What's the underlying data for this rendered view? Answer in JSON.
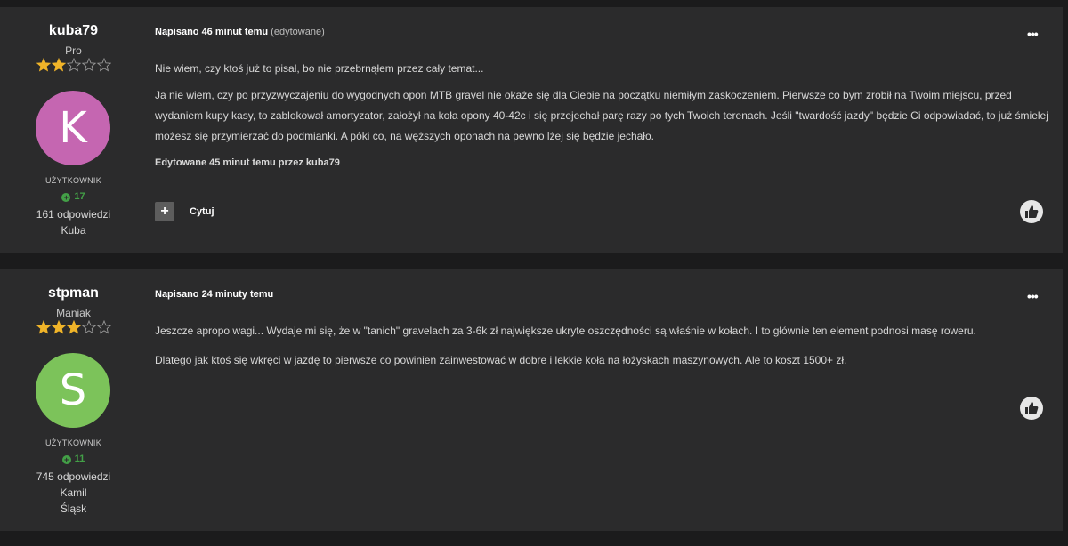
{
  "posts": [
    {
      "username": "kuba79",
      "rank": "Pro",
      "stars_filled": 2,
      "stars_total": 5,
      "avatar_letter": "K",
      "avatar_color": "#c566b1",
      "role": "UŻYTKOWNIK",
      "reputation": "17",
      "replies": "161 odpowiedzi",
      "name": "Kuba",
      "location": "",
      "posted": "Napisano 46 minut temu",
      "edited_flag": "(edytowane)",
      "paragraphs": [
        "Nie wiem, czy ktoś już to pisał, bo nie przebrnąłem przez cały temat...",
        "Ja nie wiem, czy po przyzwyczajeniu do wygodnych opon MTB gravel nie okaże się dla Ciebie na początku niemiłym zaskoczeniem. Pierwsze co bym zrobił na Twoim miejscu, przed wydaniem kupy kasy, to zablokował amortyzator, założył na koła opony 40-42c i się przejechał parę razy po tych Twoich terenach. Jeśli \"twardość jazdy\" będzie Ci odpowiadać, to już śmielej możesz się przymierzać do podmianki. A póki co, na węższych oponach na pewno lżej się będzie jechało."
      ],
      "edit_note": "Edytowane 45 minut temu przez kuba79",
      "quote_label": "Cytuj",
      "plus_label": "+",
      "more_label": "•••"
    },
    {
      "username": "stpman",
      "rank": "Maniak",
      "stars_filled": 3,
      "stars_total": 5,
      "avatar_letter": "S",
      "avatar_color": "#7cc35a",
      "role": "UŻYTKOWNIK",
      "reputation": "11",
      "replies": "745 odpowiedzi",
      "name": "Kamil",
      "location": "Śląsk",
      "posted": "Napisano 24 minuty temu",
      "edited_flag": "",
      "paragraphs": [
        "Jeszcze apropo wagi... Wydaje mi się, że w \"tanich\" gravelach za 3-6k zł największe ukryte oszczędności są właśnie w kołach. I to głównie ten element podnosi masę roweru.",
        "Dlatego jak ktoś się wkręci w jazdę to pierwsze co powinien zainwestować w dobre i lekkie koła na łożyskach maszynowych. Ale to koszt 1500+ zł."
      ],
      "edit_note": "",
      "quote_label": "",
      "plus_label": "",
      "more_label": "•••"
    }
  ],
  "colors": {
    "star": "#f0b429",
    "rep": "#43a047",
    "panel": "#2b2b2c",
    "background": "#1b1b1c"
  }
}
